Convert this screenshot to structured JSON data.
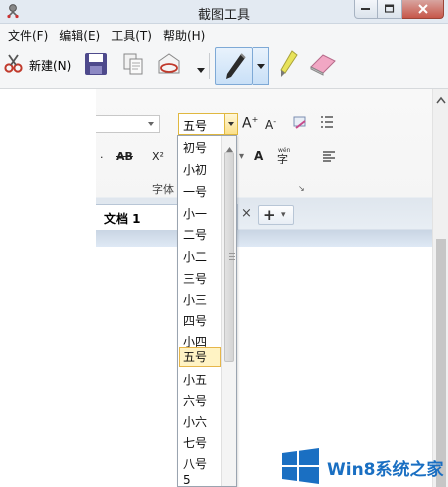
{
  "window": {
    "title": "截图工具"
  },
  "menu": {
    "items": [
      "文件(F)",
      "编辑(E)",
      "工具(T)",
      "帮助(H)"
    ]
  },
  "toolbar": {
    "new_label": "新建(N)"
  },
  "captured": {
    "font_size_value": "五号",
    "ribbon_group_label": "字体",
    "doc_tab_label": "文档 1",
    "tab_close_glyph": "×",
    "new_tab_glyph": "+"
  },
  "dropdown": {
    "items": [
      "初号",
      "小初",
      "一号",
      "小一",
      "二号",
      "小二",
      "三号",
      "小三",
      "四号",
      "小四",
      "五号",
      "小五",
      "六号",
      "小六",
      "七号",
      "八号",
      "5"
    ],
    "selected": "五号"
  },
  "watermark": {
    "text": "Win8系统之家"
  },
  "colors": {
    "accent": "#1a6fc2",
    "selection": "#fff3c4"
  }
}
